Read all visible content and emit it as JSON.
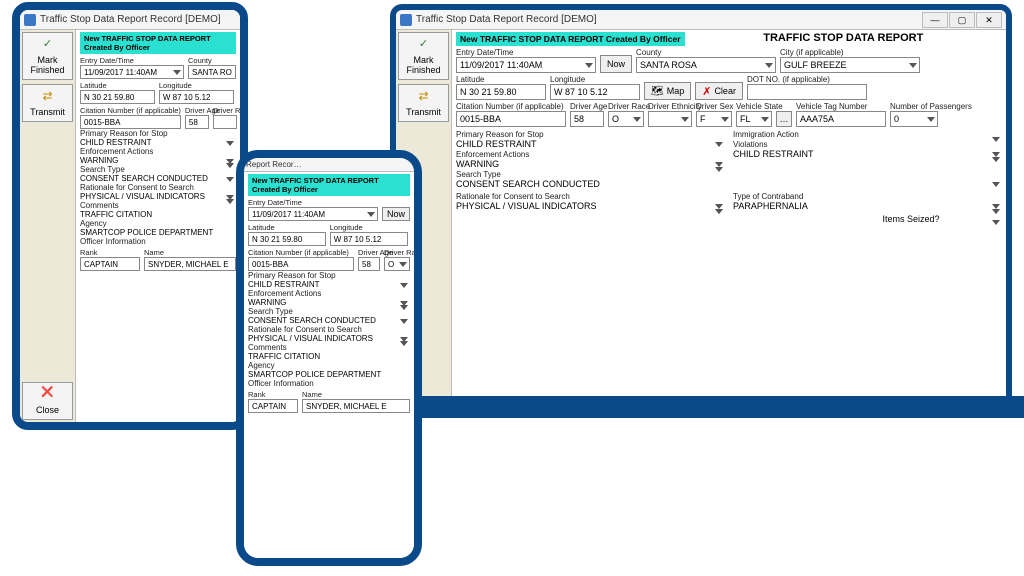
{
  "window": {
    "title": "Traffic Stop Data Report Record [DEMO]",
    "banner": "New TRAFFIC STOP DATA REPORT Created By Officer",
    "page_title": "TRAFFIC STOP DATA REPORT"
  },
  "toolbar": {
    "mark_finished": "Mark Finished",
    "transmit": "Transmit",
    "close": "Close"
  },
  "btns": {
    "now": "Now",
    "map": "Map",
    "clear": "Clear",
    "items_seized_label": "Items Seized?"
  },
  "labels": {
    "entry_datetime": "Entry Date/Time",
    "county": "County",
    "city": "City (if applicable)",
    "latitude": "Latitude",
    "longitude": "Longitude",
    "dot_no": "DOT NO. (if applicable)",
    "citation_no": "Citation Number (if applicable)",
    "driver_age": "Driver Age",
    "driver_race": "Driver Race",
    "driver_ethnicity": "Driver Ethnicity",
    "driver_sex": "Driver Sex",
    "vehicle_state": "Vehicle State",
    "vehicle_tag": "Vehicle Tag Number",
    "passengers": "Number of Passengers",
    "primary_reason": "Primary Reason for Stop",
    "immigration": "Immigration Action",
    "enforcement_actions": "Enforcement Actions",
    "violations": "Violations",
    "search_type": "Search Type",
    "rationale": "Rationale for Consent to Search",
    "contraband": "Type of Contraband",
    "comments": "Comments",
    "agency": "Agency",
    "officer_info": "Officer Information",
    "rank": "Rank",
    "name": "Name"
  },
  "values": {
    "entry_datetime": "11/09/2017 11:40AM",
    "county": "SANTA ROSA",
    "city": "GULF BREEZE",
    "latitude": "N 30 21 59.80",
    "longitude": "W 87 10 5.12",
    "dot_no": "",
    "citation_no": "0015-BBA",
    "driver_age": "58",
    "driver_race": "O",
    "driver_ethnicity": "",
    "driver_sex": "F",
    "vehicle_state": "FL",
    "vehicle_tag": "AAA75A",
    "passengers": "0",
    "primary_reason": "CHILD RESTRAINT",
    "enforcement_actions": "WARNING",
    "violations": "CHILD RESTRAINT",
    "search_type": "CONSENT SEARCH CONDUCTED",
    "rationale": "PHYSICAL / VISUAL INDICATORS",
    "contraband": "PARAPHERNALIA",
    "comments": "TRAFFIC CITATION",
    "agency": "SMARTCOP POLICE DEPARTMENT",
    "rank": "CAPTAIN",
    "officer_name": "SNYDER, MICHAEL E"
  },
  "tablet": {
    "county": "SANTA RO"
  }
}
